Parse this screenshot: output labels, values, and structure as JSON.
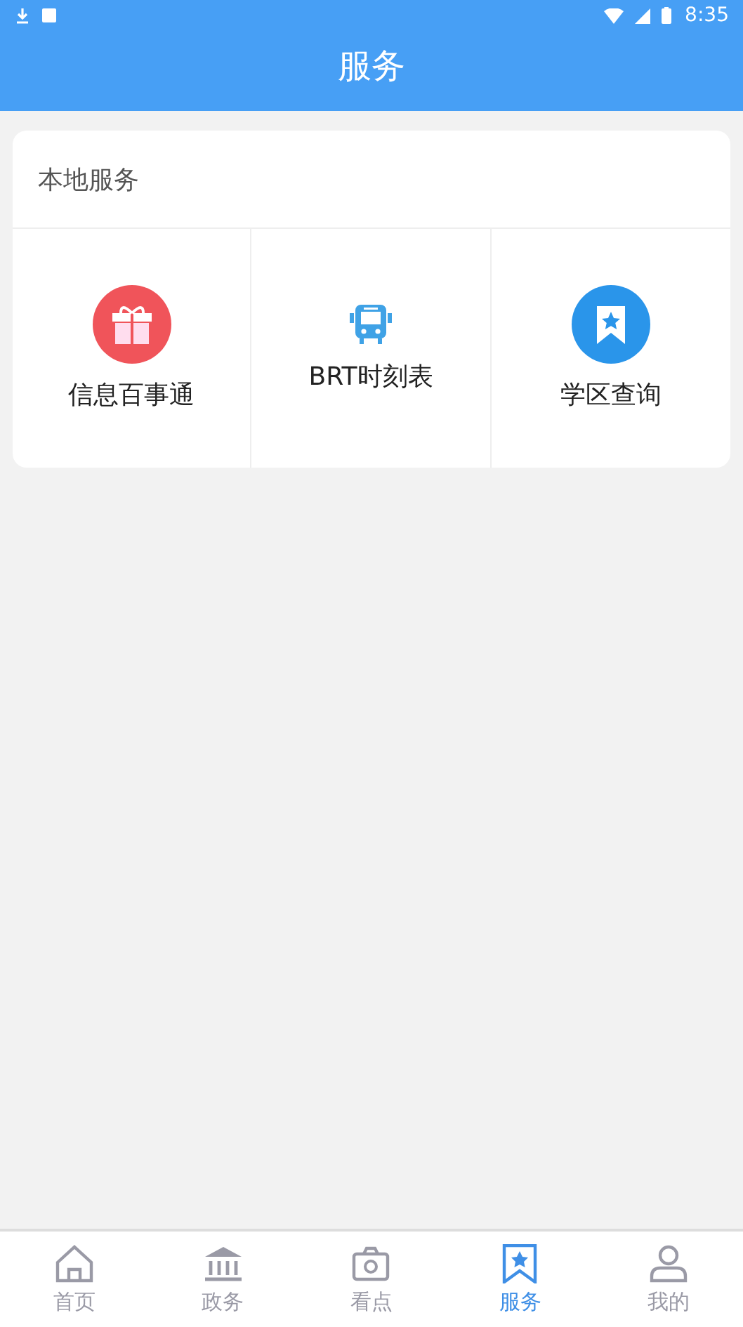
{
  "status_bar": {
    "time": "8:35"
  },
  "header": {
    "title": "服务"
  },
  "section": {
    "title": "本地服务",
    "items": [
      {
        "label": "信息百事通",
        "kind": "gift"
      },
      {
        "label": "BRT时刻表",
        "kind": "bus"
      },
      {
        "label": "学区查询",
        "kind": "bookmark"
      }
    ]
  },
  "tab_bar": [
    {
      "label": "首页",
      "kind": "home",
      "selected": false
    },
    {
      "label": "政务",
      "kind": "bank",
      "selected": false
    },
    {
      "label": "看点",
      "kind": "camera",
      "selected": false
    },
    {
      "label": "服务",
      "kind": "bookmark",
      "selected": true
    },
    {
      "label": "我的",
      "kind": "user",
      "selected": false
    }
  ]
}
